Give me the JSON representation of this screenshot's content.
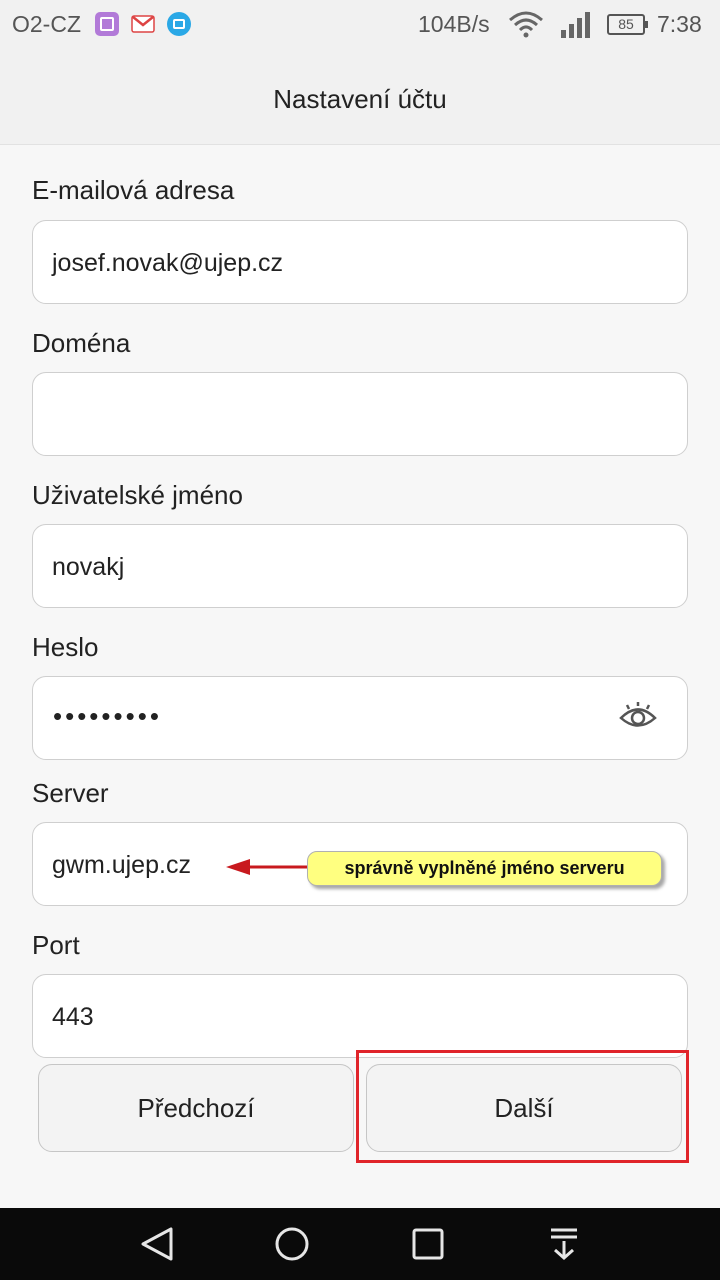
{
  "status_bar": {
    "carrier": "O2-CZ",
    "network_speed": "104B/s",
    "battery_level": "85",
    "time": "7:38",
    "notification_icons": [
      "gallery-icon",
      "gmail-icon",
      "cloud-icon"
    ]
  },
  "header": {
    "title": "Nastavení účtu"
  },
  "form": {
    "email": {
      "label": "E-mailová adresa",
      "value": "josef.novak@ujep.cz"
    },
    "domain": {
      "label": "Doména",
      "value": ""
    },
    "username": {
      "label": "Uživatelské jméno",
      "value": "novakj"
    },
    "password": {
      "label": "Heslo",
      "masked_value": "•••••••••",
      "toggle_icon": "eye-icon"
    },
    "server": {
      "label": "Server",
      "value": "gwm.ujep.cz"
    },
    "port": {
      "label": "Port",
      "value": "443"
    }
  },
  "annotation": {
    "callout_text": "správně vyplněné jméno serveru",
    "callout_color": "#ffff80",
    "highlight_color": "#e0242a"
  },
  "buttons": {
    "previous": "Předchozí",
    "next": "Další"
  },
  "nav_bar": {
    "icons": [
      "back-icon",
      "home-icon",
      "recents-icon",
      "notification-pull-icon"
    ]
  }
}
